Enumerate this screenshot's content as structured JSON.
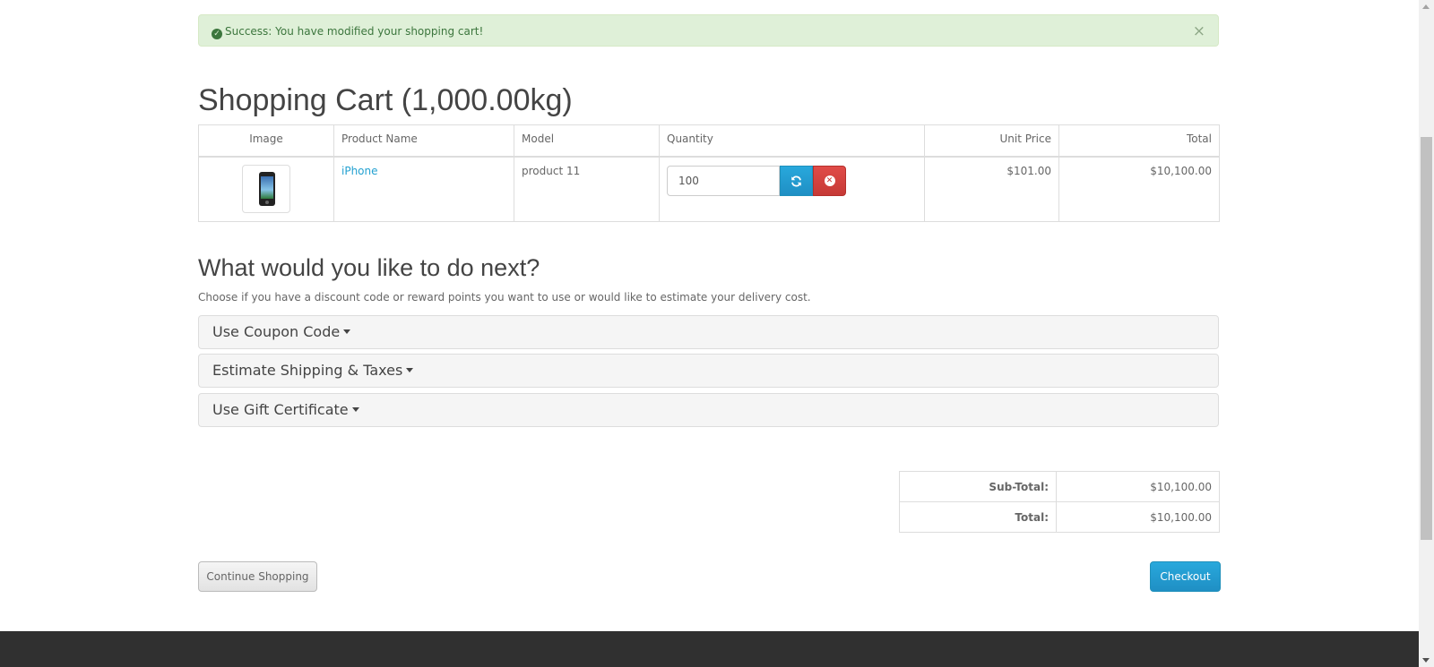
{
  "alert": {
    "message": "Success: You have modified your shopping cart!",
    "close_symbol": "×",
    "icon": "check-circle-icon",
    "color": "#3c763d",
    "background": "#dff0d8"
  },
  "cart": {
    "title": "Shopping Cart  (1,000.00kg)",
    "columns": [
      "Image",
      "Product Name",
      "Model",
      "Quantity",
      "Unit Price",
      "Total"
    ],
    "items": [
      {
        "image": "iphone-thumbnail",
        "name": "iPhone",
        "model": "product 11",
        "quantity": "100",
        "unit_price": "$101.00",
        "total": "$10,100.00"
      }
    ],
    "update_icon": "refresh-icon",
    "remove_icon": "times-circle-icon"
  },
  "next": {
    "title": "What would you like to do next?",
    "description": "Choose if you have a discount code or reward points you want to use or would like to estimate your delivery cost.",
    "panels": [
      "Use Coupon Code",
      "Estimate Shipping & Taxes",
      "Use Gift Certificate"
    ]
  },
  "totals": [
    {
      "label": "Sub-Total:",
      "value": "$10,100.00"
    },
    {
      "label": "Total:",
      "value": "$10,100.00"
    }
  ],
  "buttons": {
    "continue": "Continue Shopping",
    "checkout": "Checkout",
    "accent": "#229ac8",
    "danger": "#da4f49"
  }
}
